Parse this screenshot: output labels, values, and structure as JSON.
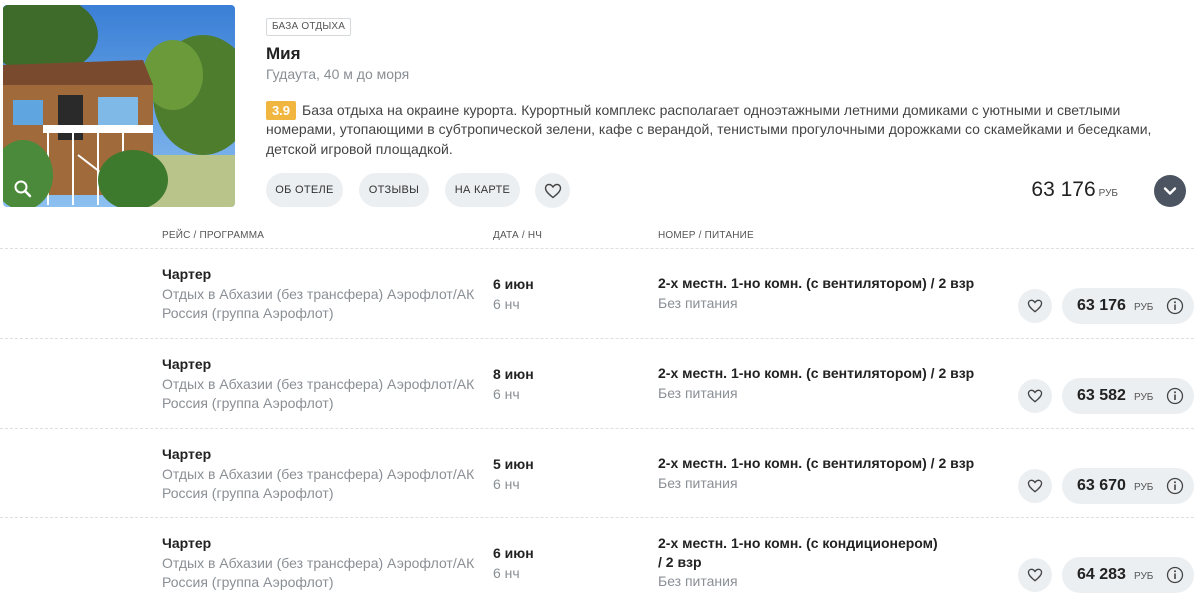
{
  "hotel": {
    "type_badge": "БАЗА ОТДЫХА",
    "name": "Мия",
    "location": "Гудаута, 40 м до моря",
    "rating": "3.9",
    "description": "База отдыха на окраине курорта. Курортный комплекс располагает одноэтажными летними домиками с уютными и светлыми номерами, утопающими в субтропической зелени, кафе с верандой, тенистыми прогулочными дорожками со скамейками и беседками, детской игровой площадкой.",
    "buttons": {
      "about": "ОБ ОТЕЛЕ",
      "reviews": "ОТЗЫВЫ",
      "map": "НА КАРТЕ"
    },
    "price": "63 176",
    "currency": "РУБ",
    "icons": [
      "search-icon",
      "heart-icon",
      "chevron-down-icon"
    ]
  },
  "table": {
    "headers": {
      "flight": "РЕЙС / ПРОГРАММА",
      "date": "ДАТА / НЧ",
      "room": "НОМЕР / ПИТАНИЕ"
    },
    "rows": [
      {
        "flight_type": "Чартер",
        "program": "Отдых в Абхазии (без трансфера) Аэрофлот/АК Россия (группа Аэрофлот)",
        "date": "6 июн",
        "nights": "6 нч",
        "room": "2-х местн. 1-но комн. (с вентилятором) / 2 взр",
        "meal": "Без питания",
        "price": "63 176",
        "currency": "РУБ"
      },
      {
        "flight_type": "Чартер",
        "program": "Отдых в Абхазии (без трансфера) Аэрофлот/АК Россия (группа Аэрофлот)",
        "date": "8 июн",
        "nights": "6 нч",
        "room": "2-х местн. 1-но комн. (с вентилятором) / 2 взр",
        "meal": "Без питания",
        "price": "63 582",
        "currency": "РУБ"
      },
      {
        "flight_type": "Чартер",
        "program": "Отдых в Абхазии (без трансфера) Аэрофлот/АК Россия (группа Аэрофлот)",
        "date": "5 июн",
        "nights": "6 нч",
        "room": "2-х местн. 1-но комн. (с вентилятором) / 2 взр",
        "meal": "Без питания",
        "price": "63 670",
        "currency": "РУБ"
      },
      {
        "flight_type": "Чартер",
        "program": "Отдых в Абхазии (без трансфера) Аэрофлот/АК Россия (группа Аэрофлот)",
        "date": "6 июн",
        "nights": "6 нч",
        "room": "2-х местн. 1-но комн. (с кондиционером)\n / 2 взр",
        "meal": "Без питания",
        "price": "64 283",
        "currency": "РУБ"
      }
    ]
  },
  "colors": {
    "rating_badge": "#f0b640",
    "pill_bg": "#eceff2",
    "expand_btn": "#4c5461",
    "muted_text": "#8a8f95"
  }
}
